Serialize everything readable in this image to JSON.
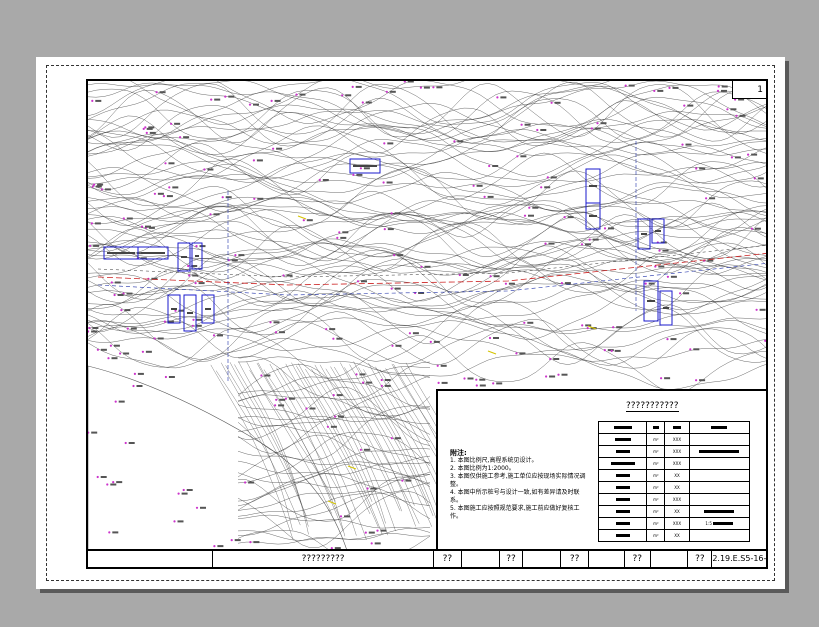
{
  "drawing": {
    "sheet_ref": "1",
    "plan_title": "???????????",
    "strip_title": "?????????",
    "strip_labels": [
      "??",
      "??",
      "??",
      "??",
      "??"
    ],
    "drawing_number": "2.19.E.S5-16-1"
  },
  "notes": {
    "heading": "附注:",
    "lines": [
      "1. 本图比例尺,高程系统见设计。",
      "2. 本图比例为1:2000。",
      "3. 本图仅供施工参考,施工单位应按现场实际情况调整。",
      "4. 本图中所示桩号与设计一致,如有差异请及时联系。",
      "5. 本图施工应按照规范要求,施工前应做好复核工作。"
    ]
  },
  "legend": {
    "units": [
      "m²",
      "m²",
      "m²",
      "m²",
      "m²",
      "m²",
      "m²",
      "m²",
      "m²"
    ],
    "codes": [
      "XXX",
      "XXX",
      "XXX",
      "XX",
      "XX",
      "XXX",
      "XX",
      "XXX",
      "XX",
      "XXX"
    ],
    "extra_label": "1:5"
  },
  "colors": {
    "background": "#a9a9a9",
    "contour": "#3a3a3a",
    "survey_point": "#cc33cc",
    "route_red": "#cc2222",
    "route_blue": "#2233aa",
    "label_box": "#1a1acc"
  }
}
